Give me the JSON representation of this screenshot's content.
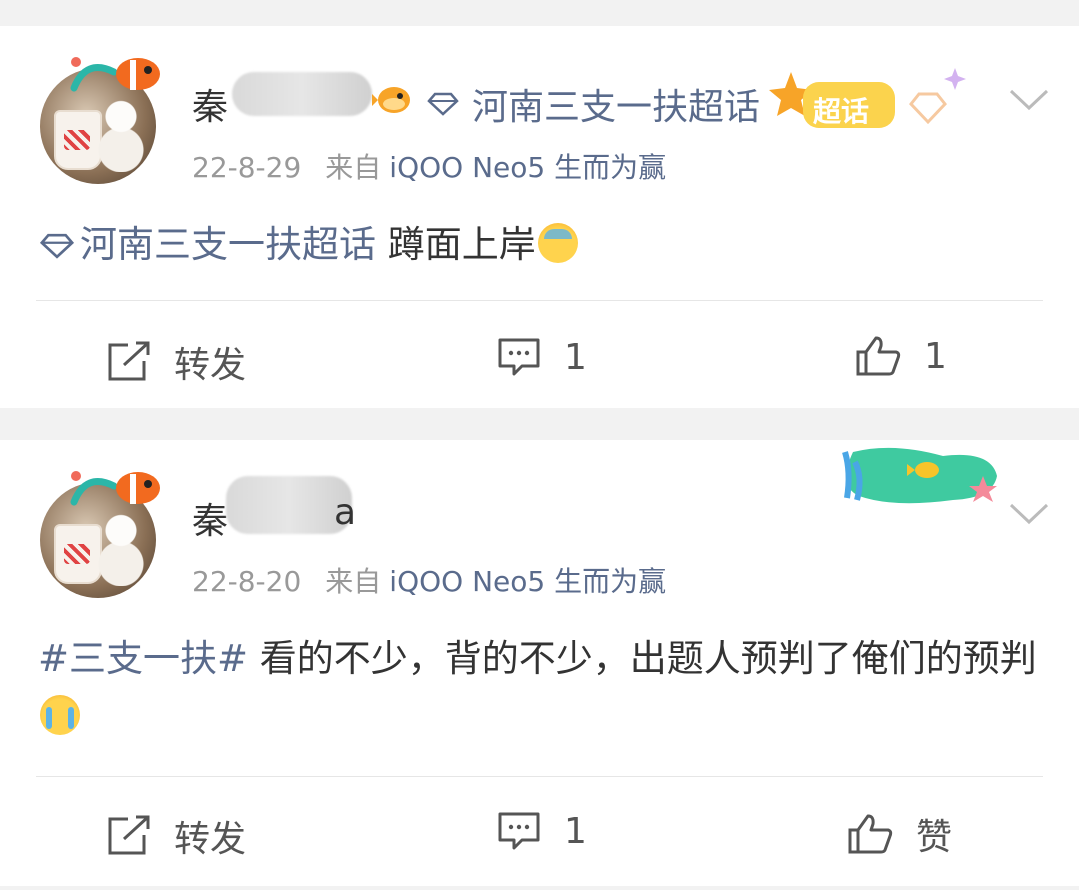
{
  "posts": [
    {
      "name_prefix": "秦",
      "name_suffix": "",
      "date": "22-8-29",
      "source_prefix": "来自",
      "device": "iQOO Neo5 生而为赢",
      "topic_badge": "河南三支一扶超话",
      "super_badge": "超话",
      "body_topic": "河南三支一扶超话",
      "body_text": " 蹲面上岸",
      "actions": {
        "repost": "转发",
        "comment": "1",
        "like": "1"
      }
    },
    {
      "name_prefix": "秦",
      "name_suffix": "a",
      "date": "22-8-20",
      "source_prefix": "来自",
      "device": "iQOO Neo5 生而为赢",
      "body_topic": "#三支一扶#",
      "body_text": " 看的不少，背的不少，出题人预判了俺们的预判",
      "actions": {
        "repost": "转发",
        "comment": "1",
        "like": "赞"
      }
    }
  ],
  "colors": {
    "link": "#5a6b8c",
    "text": "#333333",
    "meta": "#999999",
    "bg": "#f2f2f2"
  },
  "icons": [
    "diamond-icon",
    "chevron-down-icon",
    "repost-icon",
    "comment-icon",
    "like-icon",
    "fish-icon"
  ]
}
